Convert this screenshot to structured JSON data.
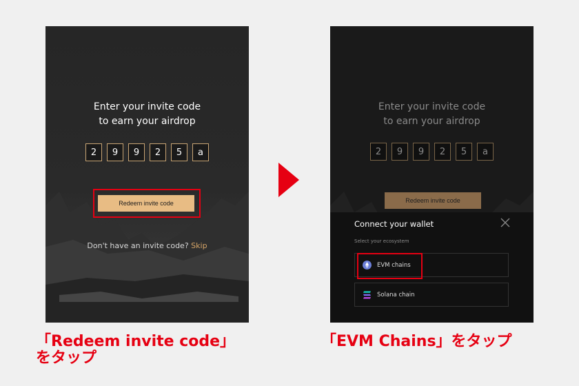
{
  "left_screen": {
    "title_line1": "Enter your invite code",
    "title_line2": "to earn your airdrop",
    "code_digits": [
      "2",
      "9",
      "9",
      "2",
      "5",
      "a"
    ],
    "redeem_label": "Redeem invite code",
    "no_code_text": "Don't have an invite code?",
    "skip_label": "Skip"
  },
  "right_screen": {
    "title_line1": "Enter your invite code",
    "title_line2": "to earn your airdrop",
    "code_digits": [
      "2",
      "9",
      "9",
      "2",
      "5",
      "a"
    ],
    "redeem_label": "Redeem invite code",
    "sheet": {
      "title": "Connect your wallet",
      "subtitle": "Select your ecosystem",
      "options": [
        {
          "label": "EVM chains",
          "icon": "ethereum-icon"
        },
        {
          "label": "Solana chain",
          "icon": "solana-icon"
        }
      ]
    }
  },
  "captions": {
    "left_line1": "「Redeem invite code」",
    "left_line2": "をタップ",
    "right": "「EVM Chains」をタップ"
  },
  "colors": {
    "highlight": "#e60012",
    "accent": "#e8bc84",
    "skip": "#d6a567"
  }
}
